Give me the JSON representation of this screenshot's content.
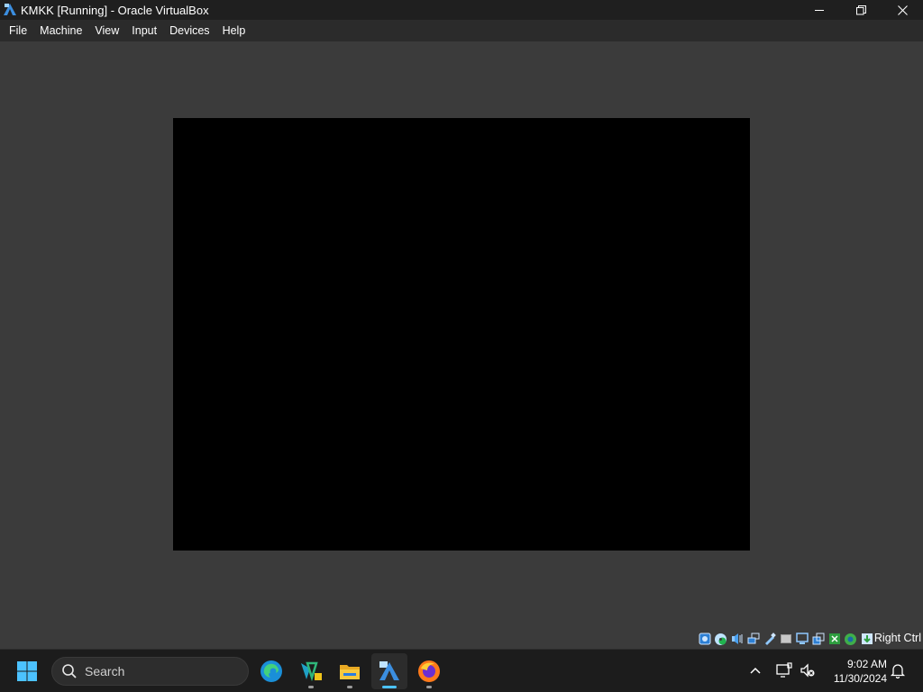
{
  "window": {
    "title": "KMKK [Running] - Oracle VirtualBox",
    "icon": "virtualbox-icon"
  },
  "menu": {
    "items": [
      {
        "label": "File"
      },
      {
        "label": "Machine"
      },
      {
        "label": "View"
      },
      {
        "label": "Input"
      },
      {
        "label": "Devices"
      },
      {
        "label": "Help"
      }
    ]
  },
  "statusbar": {
    "icons": [
      "hard-disk-icon",
      "optical-drive-icon",
      "audio-icon",
      "network-icon",
      "usb-icon",
      "shared-folders-icon",
      "display-icon",
      "video-capture-icon",
      "recording-icon",
      "cpu-icon",
      "mouse-integration-icon",
      "keyboard-icon"
    ],
    "host_key": "Right Ctrl"
  },
  "taskbar": {
    "search_label": "Search",
    "apps": [
      "edge-icon",
      "visual-studio-icon",
      "file-explorer-icon",
      "virtualbox-icon",
      "firefox-icon"
    ],
    "time": "9:02 AM",
    "date": "11/30/2024"
  }
}
